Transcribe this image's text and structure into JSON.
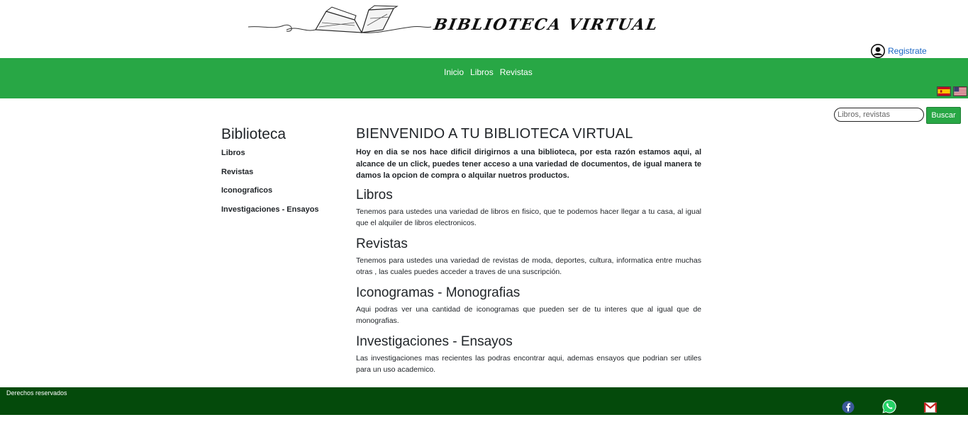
{
  "header": {
    "logo_text": "BIBLIOTECA VIRTUAL",
    "register_label": "Registrate"
  },
  "nav": {
    "items": [
      {
        "label": "Inicio"
      },
      {
        "label": "Libros"
      },
      {
        "label": "Revistas"
      }
    ],
    "languages": [
      "es-flag-icon",
      "us-flag-icon"
    ]
  },
  "search": {
    "placeholder": "Libros, revistas",
    "button_label": "Buscar"
  },
  "sidebar": {
    "title": "Biblioteca",
    "items": [
      {
        "label": "Libros"
      },
      {
        "label": "Revistas"
      },
      {
        "label": "Iconograficos"
      },
      {
        "label": "Investigaciones - Ensayos"
      }
    ]
  },
  "main": {
    "title": "BIENVENIDO A TU BIBLIOTECA VIRTUAL",
    "intro": "Hoy en dia se nos hace dificil dirigirnos a una biblioteca, por esta razón estamos aqui, al alcance de un click, puedes tener acceso a una variedad de documentos, de igual manera te damos la opcion de compra o alquilar nuetros productos.",
    "sections": [
      {
        "title": "Libros",
        "text": "Tenemos para ustedes una variedad de libros en fisico, que te podemos hacer llegar a tu casa, al igual que el alquiler de libros electronicos."
      },
      {
        "title": "Revistas",
        "text": "Tenemos para ustedes una variedad de revistas de moda, deportes, cultura, informatica entre muchas otras , las cuales puedes acceder a traves de una suscripción."
      },
      {
        "title": "Iconogramas - Monografias",
        "text": "Aqui podras ver una cantidad de iconogramas que pueden ser de tu interes que al igual que de monografias."
      },
      {
        "title": "Investigaciones - Ensayos",
        "text": "Las investigaciones mas recientes las podras encontrar aqui, ademas ensayos que podrian ser utiles para un uso academico."
      }
    ]
  },
  "footer": {
    "rights": "Derechos reservados",
    "social": [
      "facebook-icon",
      "whatsapp-icon",
      "gmail-icon"
    ]
  },
  "colors": {
    "nav_green": "#28a745",
    "footer_green": "#044a0b",
    "link_blue": "#1a66c4"
  }
}
